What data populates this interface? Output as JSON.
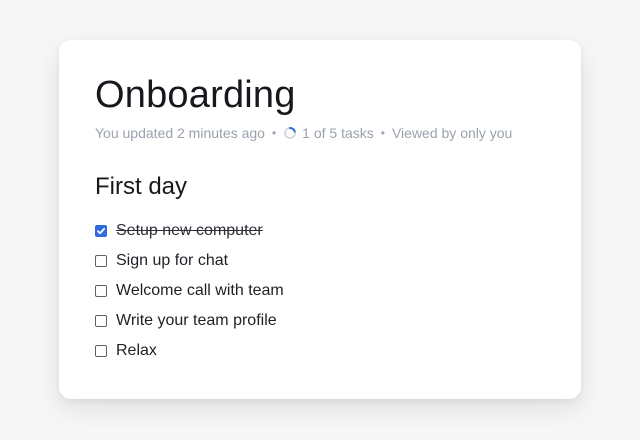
{
  "doc": {
    "title": "Onboarding"
  },
  "meta": {
    "updated": "You updated 2 minutes ago",
    "progress_text": "1 of 5 tasks",
    "progress_fraction": 0.2,
    "visibility": "Viewed by only you",
    "separator": "•"
  },
  "section": {
    "title": "First day",
    "tasks": [
      {
        "label": "Setup new computer",
        "checked": true
      },
      {
        "label": "Sign up for chat",
        "checked": false
      },
      {
        "label": "Welcome call with team",
        "checked": false
      },
      {
        "label": "Write your team profile",
        "checked": false
      },
      {
        "label": "Relax",
        "checked": false
      }
    ]
  },
  "colors": {
    "accent": "#2f6bdc",
    "muted_text": "#9aa2ad"
  }
}
